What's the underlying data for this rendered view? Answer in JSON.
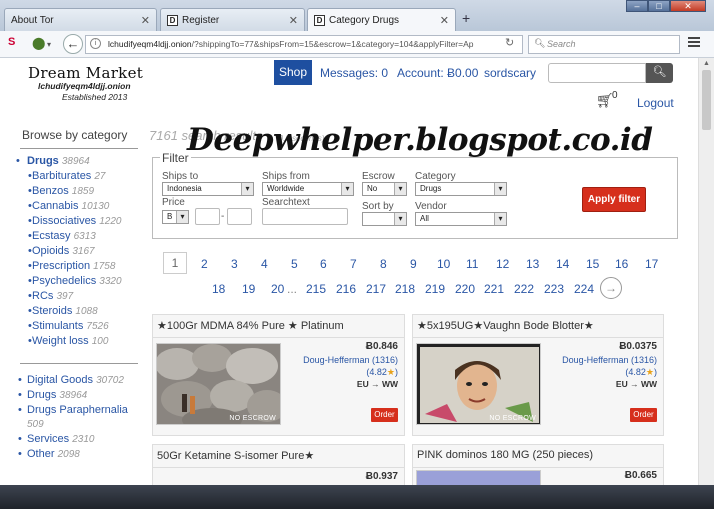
{
  "browser": {
    "tabs": [
      {
        "label": "About Tor",
        "icon": "tor-icon"
      },
      {
        "label": "Register",
        "icon": "dream-favicon"
      },
      {
        "label": "Category Drugs",
        "icon": "dream-favicon",
        "active": true
      }
    ],
    "new_tab": "+",
    "url_host": "lchudifyeqm4ldjj.onion",
    "url_path": "/?shippingTo=77&shipsFrom=15&escrow=1&category=104&applyFilter=Ap",
    "search_placeholder": "Search"
  },
  "header": {
    "logo_title": "Dream Market",
    "logo_domain": "lchudifyeqm4ldjj.onion",
    "logo_established": "Established 2013",
    "shop": "Shop",
    "messages": "Messages: 0",
    "account": "Account: Ƀ0.00",
    "username": "sordscary",
    "cart_count": "0",
    "logout": "Logout"
  },
  "sidebar": {
    "heading": "Browse by category",
    "categories": [
      {
        "label": "Drugs",
        "count": "38964"
      },
      {
        "label": "Barbiturates",
        "count": "27"
      },
      {
        "label": "Benzos",
        "count": "1859"
      },
      {
        "label": "Cannabis",
        "count": "10130"
      },
      {
        "label": "Dissociatives",
        "count": "1220"
      },
      {
        "label": "Ecstasy",
        "count": "6313"
      },
      {
        "label": "Opioids",
        "count": "3167"
      },
      {
        "label": "Prescription",
        "count": "1758"
      },
      {
        "label": "Psychedelics",
        "count": "3320"
      },
      {
        "label": "RCs",
        "count": "397"
      },
      {
        "label": "Steroids",
        "count": "1088"
      },
      {
        "label": "Stimulants",
        "count": "7526"
      },
      {
        "label": "Weight loss",
        "count": "100"
      }
    ],
    "other": [
      {
        "label": "Digital Goods",
        "count": "30702"
      },
      {
        "label": "Drugs",
        "count": "38964"
      },
      {
        "label": "Drugs Paraphernalia",
        "count": "509"
      },
      {
        "label": "Services",
        "count": "2310"
      },
      {
        "label": "Other",
        "count": "2098"
      }
    ]
  },
  "results": {
    "count_text": "7161 search results",
    "count_sub": "(0.0 seconds)",
    "watermark": "Deepwhelper.blogspot.co.id"
  },
  "filter": {
    "title": "Filter",
    "ships_to_label": "Ships to",
    "ships_to_value": "Indonesia",
    "ships_from_label": "Ships from",
    "ships_from_value": "Worldwide",
    "escrow_label": "Escrow",
    "escrow_value": "No",
    "category_label": "Category",
    "category_value": "Drugs",
    "price_label": "Price",
    "price_currency": "B",
    "price_dash": "-",
    "searchtext_label": "Searchtext",
    "sortby_label": "Sort by",
    "sortby_value": "",
    "vendor_label": "Vendor",
    "vendor_value": "All",
    "apply": "Apply filter"
  },
  "pagination": {
    "row1": [
      "1",
      "2",
      "3",
      "4",
      "5",
      "6",
      "7",
      "8",
      "9",
      "10",
      "11",
      "12",
      "13",
      "14",
      "15",
      "16",
      "17"
    ],
    "row2": [
      "18",
      "19",
      "20",
      "...",
      "215",
      "216",
      "217",
      "218",
      "219",
      "220",
      "221",
      "222",
      "223",
      "224"
    ],
    "next": "→"
  },
  "products": [
    {
      "title": "★100Gr MDMA 84% Pure ★ Platinum",
      "price": "Ƀ0.846",
      "vendor": "Doug-Hefferman (1316)",
      "rating": "(4.82★)",
      "ship": "EU → WW",
      "escrow": "NO ESCROW",
      "order": "Order"
    },
    {
      "title": "★5x195UG★Vaughn Bode Blotter★",
      "price": "Ƀ0.0375",
      "vendor": "Doug-Hefferman (1316)",
      "rating": "(4.82★)",
      "ship": "EU → WW",
      "escrow": "NO ESCROW",
      "order": "Order"
    },
    {
      "title": "50Gr Ketamine S-isomer Pure★",
      "price": "Ƀ0.937"
    },
    {
      "title": "PINK dominos 180 MG (250 pieces)",
      "price": "Ƀ0.665"
    }
  ],
  "colors": {
    "accent": "#1e4fa0",
    "link": "#2a56a5",
    "order": "#d62f1c"
  }
}
